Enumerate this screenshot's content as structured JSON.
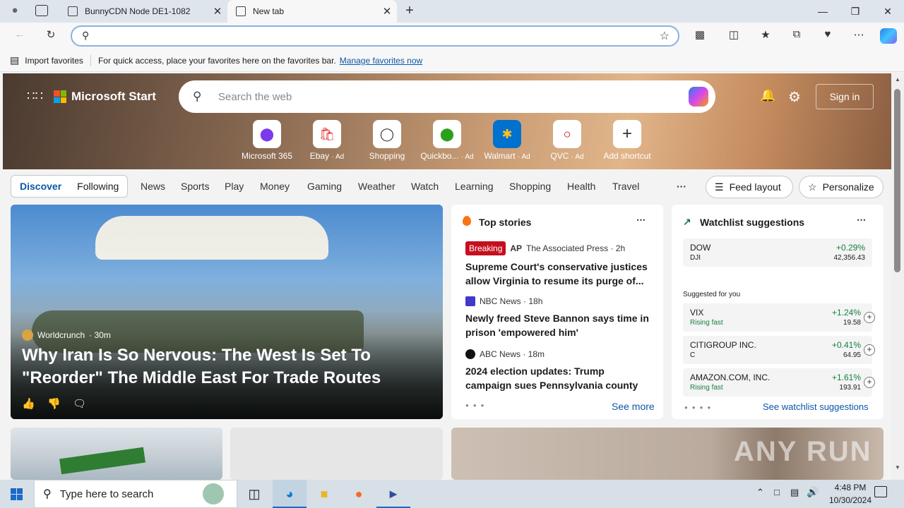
{
  "browser": {
    "tabs": [
      {
        "label": "BunnyCDN Node DE1-1082"
      },
      {
        "label": "New tab"
      }
    ],
    "favorites_bar": {
      "import_label": "Import favorites",
      "message": "For quick access, place your favorites here on the favorites bar.",
      "manage_link": "Manage favorites now"
    }
  },
  "msn": {
    "brand": "Microsoft Start",
    "search_placeholder": "Search the web",
    "sign_in": "Sign in",
    "shortcuts": [
      {
        "label": "Microsoft 365",
        "ad": ""
      },
      {
        "label": "Ebay",
        "ad": "· Ad"
      },
      {
        "label": "Shopping",
        "ad": ""
      },
      {
        "label": "Quickbo...",
        "ad": "· Ad"
      },
      {
        "label": "Walmart",
        "ad": "· Ad"
      },
      {
        "label": "QVC",
        "ad": "· Ad"
      },
      {
        "label": "Add shortcut",
        "ad": ""
      }
    ],
    "nav": {
      "discover": "Discover",
      "following": "Following",
      "items": [
        "News",
        "Sports",
        "Play",
        "Money",
        "Gaming",
        "Weather",
        "Watch",
        "Learning",
        "Shopping",
        "Health",
        "Travel"
      ],
      "more": "···",
      "feed_layout": "Feed layout",
      "personalize": "Personalize"
    },
    "main_story": {
      "source": "Worldcrunch",
      "time": "· 30m",
      "headline": "Why Iran Is So Nervous: The West Is Set To \"Reorder\" The Middle East For Trade Routes"
    },
    "top_stories": {
      "title": "Top stories",
      "items": [
        {
          "badge": "Breaking",
          "source": "The Associated Press · 2h",
          "headline": "Supreme Court's conservative justices allow Virginia to resume its purge of..."
        },
        {
          "source": "NBC News · 18h",
          "headline": "Newly freed Steve Bannon says time in prison 'empowered him'"
        },
        {
          "source": "ABC News · 18m",
          "headline": "2024 election updates: Trump campaign sues Pennsylvania county"
        }
      ],
      "see_more": "See more"
    },
    "watchlist": {
      "title": "Watchlist suggestions",
      "dow": {
        "name": "DOW",
        "sub": "DJI",
        "pct": "+0.29%",
        "value": "42,356.43"
      },
      "suggested_label": "Suggested for you",
      "stocks": [
        {
          "name": "VIX",
          "sub": "Rising fast",
          "pct": "+1.24%",
          "value": "19.58"
        },
        {
          "name": "CITIGROUP INC.",
          "sub": "C",
          "pct": "+0.41%",
          "value": "64.95"
        },
        {
          "name": "AMAZON.COM, INC.",
          "sub": "Rising fast",
          "pct": "+1.61%",
          "value": "193.91"
        }
      ],
      "see_all": "See watchlist suggestions"
    },
    "watermark": "ANY RUN"
  },
  "taskbar": {
    "search_placeholder": "Type here to search",
    "time": "4:48 PM",
    "date": "10/30/2024"
  },
  "colors": {
    "accent": "#0b57a8",
    "breaking": "#c50f1f",
    "positive": "#15803d"
  }
}
